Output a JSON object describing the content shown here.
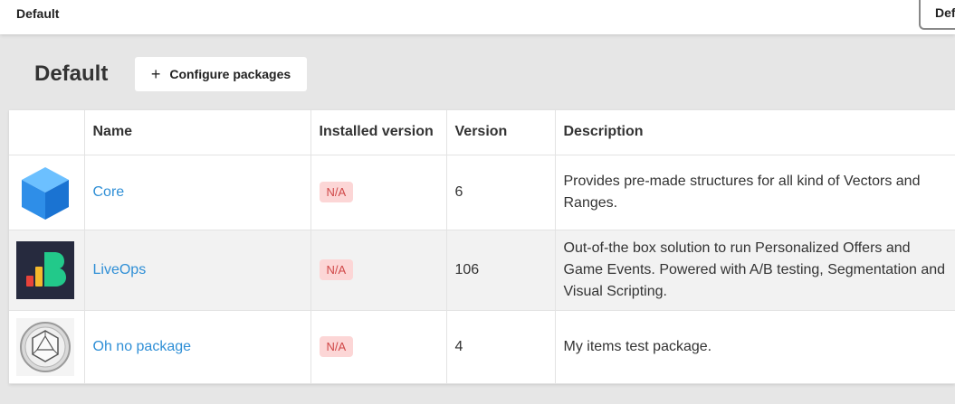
{
  "topbar": {
    "breadcrumb": "Default",
    "selector_value": "Default"
  },
  "header": {
    "title": "Default",
    "configure_label": "Configure packages",
    "configure_icon": "plus-icon"
  },
  "table": {
    "columns": [
      "",
      "Name",
      "Installed version",
      "Version",
      "Description"
    ],
    "rows": [
      {
        "icon": "blue-cube-icon",
        "name": "Core",
        "installed": "N/A",
        "version": "6",
        "description": "Provides pre-made structures for all kind of Vectors and Ranges."
      },
      {
        "icon": "liveops-logo-icon",
        "name": "LiveOps",
        "installed": "N/A",
        "version": "106",
        "description": "Out-of-the box solution to run Personalized Offers and Game Events. Powered with A/B testing, Segmentation and Visual Scripting."
      },
      {
        "icon": "d20-dice-icon",
        "name": "Oh no package",
        "installed": "N/A",
        "version": "4",
        "description": "My items test package."
      }
    ]
  },
  "colors": {
    "link": "#2f8fd6",
    "badge_bg": "#fcd6d6",
    "badge_text": "#d04848",
    "page_bg": "#e6e6e6"
  }
}
